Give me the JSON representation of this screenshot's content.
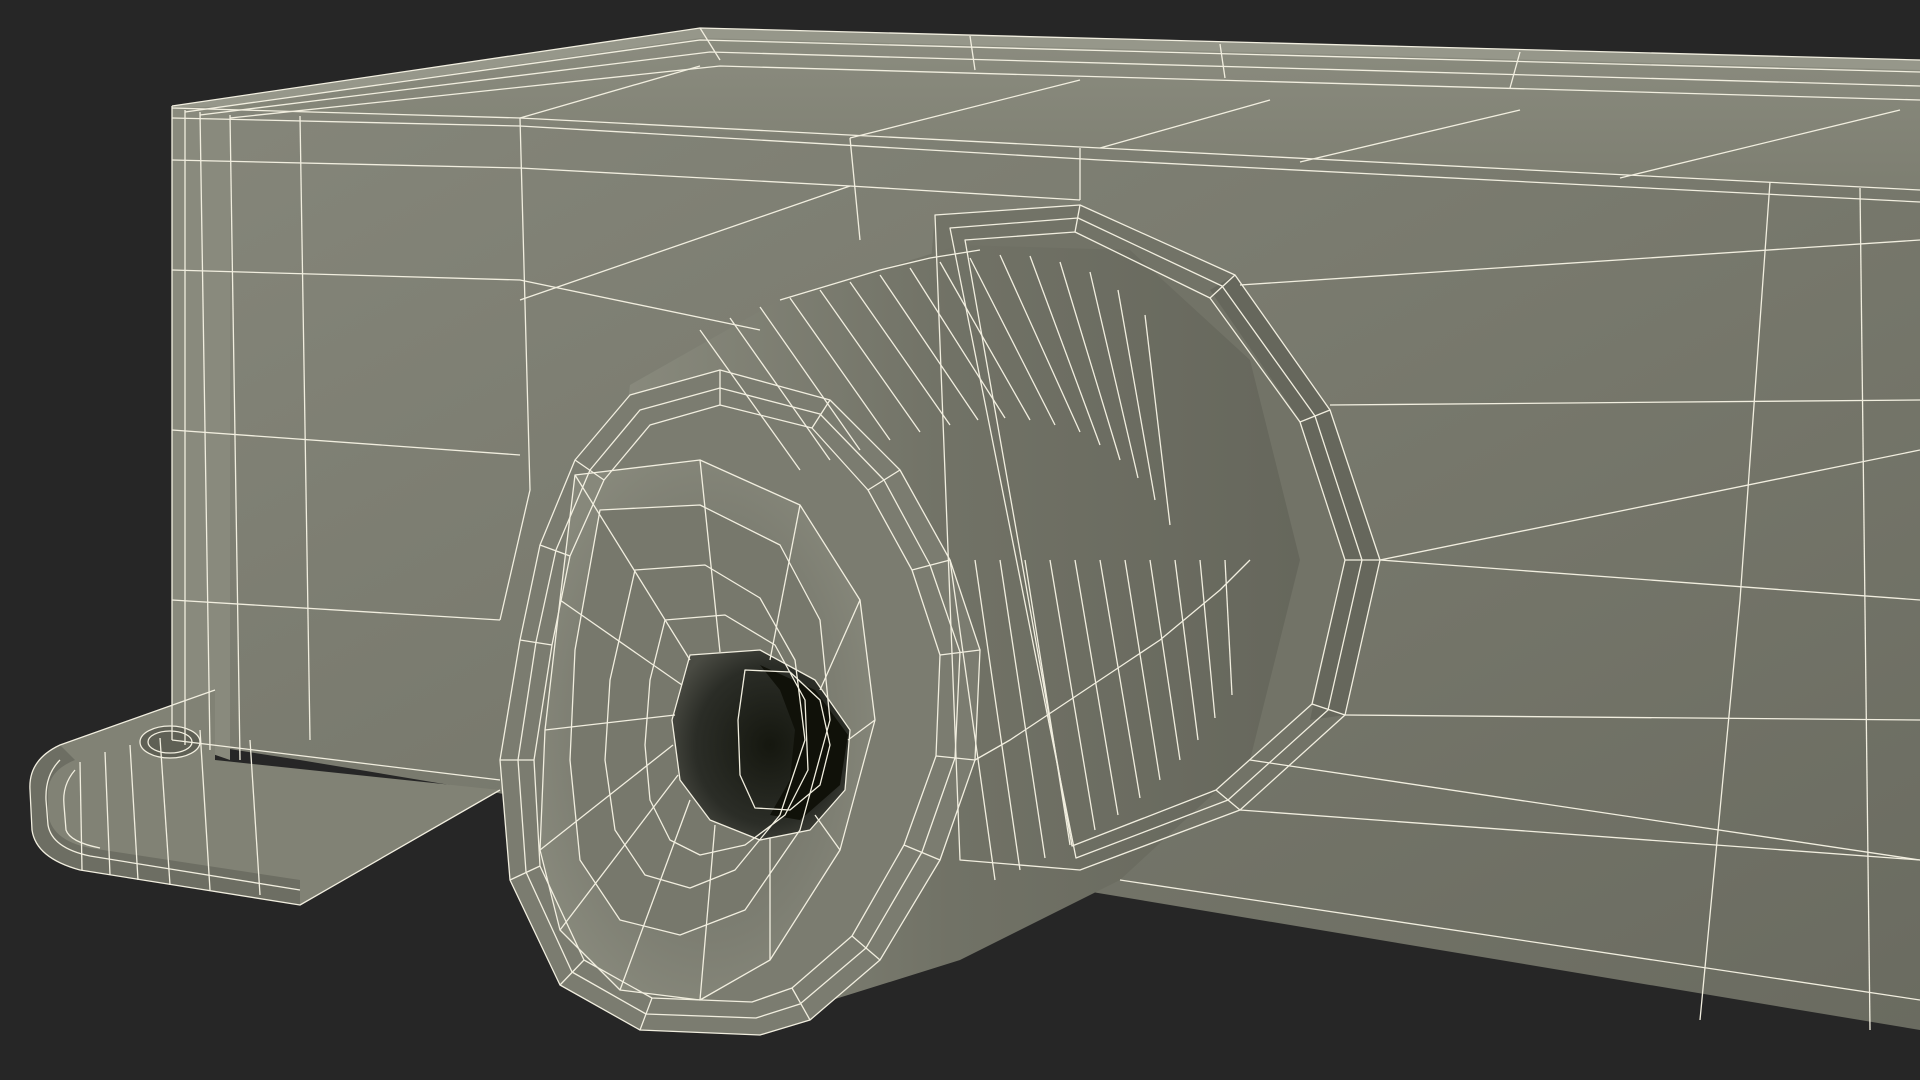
{
  "scene": {
    "subject": "wireframe-render-cable-gland-on-enclosure",
    "colors": {
      "background": "#262626",
      "surface": "#7c7d6f",
      "surface_dark": "#616257",
      "surface_light": "#8b8c7d",
      "wire": "#f1eedf",
      "hole": "#1f211d"
    }
  }
}
